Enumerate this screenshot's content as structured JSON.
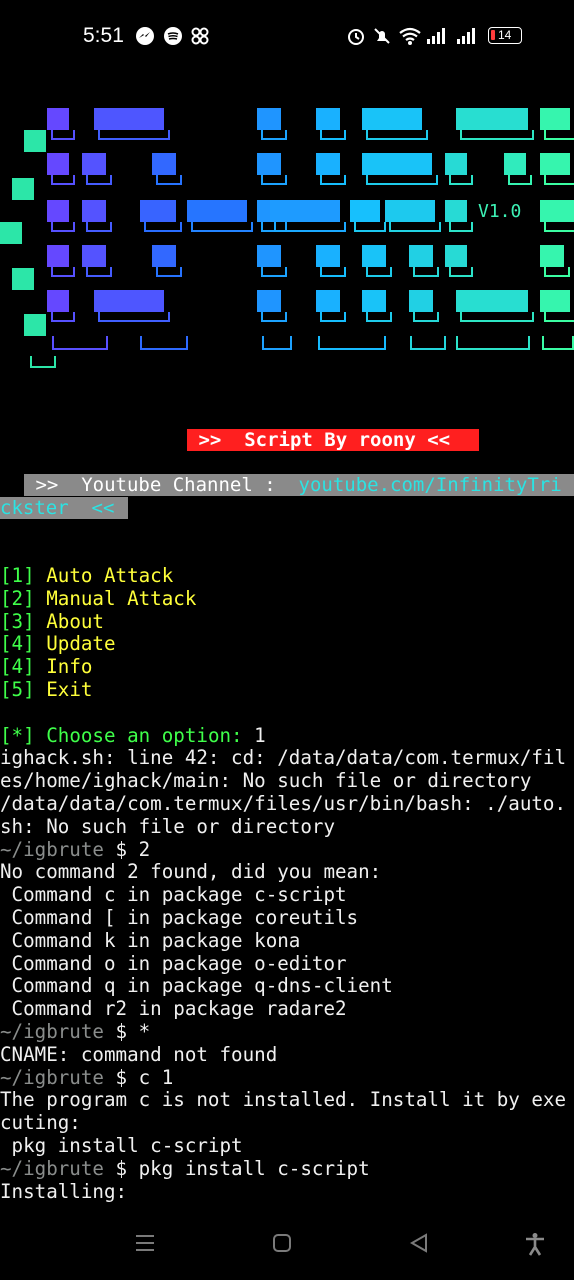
{
  "status_bar": {
    "time": "5:51",
    "battery": "14",
    "icons": [
      "messenger-icon",
      "spotify-icon",
      "app-icon",
      "alarm-icon",
      "mute-icon",
      "wifi-icon",
      "signal-icon",
      "signal-icon-2",
      "battery-icon"
    ]
  },
  "banner": {
    "version": "V1.0",
    "credit": " >>  Script By roony << ",
    "youtube_label": " >>  Youtube Channel :  ",
    "youtube_url_line1": "youtube.com/InfinityTri",
    "youtube_url_line2": "ckster",
    "youtube_end": "  <<"
  },
  "menu": {
    "items": [
      {
        "key": "[1]",
        "label": "Auto Attack"
      },
      {
        "key": "[2]",
        "label": "Manual Attack"
      },
      {
        "key": "[3]",
        "label": "About"
      },
      {
        "key": "[4]",
        "label": "Update"
      },
      {
        "key": "[4]",
        "label": "Info"
      },
      {
        "key": "[5]",
        "label": "Exit"
      }
    ],
    "prompt_marker": "[*]",
    "prompt_text": "Choose an option:",
    "prompt_value": " 1"
  },
  "output": {
    "l1": "ighack.sh: line 42: cd: /data/data/com.termux/fil",
    "l2": "es/home/ighack/main: No such file or directory",
    "l3": "/data/data/com.termux/files/usr/bin/bash: ./auto.",
    "l4": "sh: No such file or directory",
    "p1_path": "~/igbrute",
    "p1_cmd": " $ 2",
    "l5": "No command 2 found, did you mean:",
    "l6": " Command c in package c-script",
    "l7": " Command [ in package coreutils",
    "l8": " Command k in package kona",
    "l9": " Command o in package o-editor",
    "l10": " Command q in package q-dns-client",
    "l11": " Command r2 in package radare2",
    "p2_path": "~/igbrute",
    "p2_cmd": " $ *",
    "l12": "CNAME: command not found",
    "p3_path": "~/igbrute",
    "p3_cmd": " $ c 1",
    "l13": "The program c is not installed. Install it by exe",
    "l14": "cuting:",
    "l15": " pkg install c-script",
    "p4_path": "~/igbrute",
    "p4_cmd": " $ pkg install c-script",
    "l16": "Installing:"
  },
  "nav_bar": {
    "icons": [
      "menu-icon",
      "home-icon",
      "back-icon",
      "accessibility-icon"
    ]
  }
}
